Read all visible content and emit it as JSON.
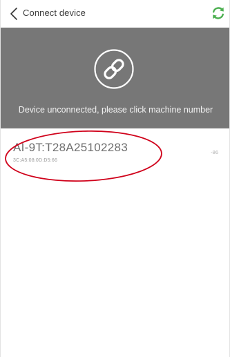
{
  "header": {
    "title": "Connect device",
    "back_icon": "chevron-left-icon",
    "refresh_icon": "refresh-icon",
    "accent_color": "#4caf50"
  },
  "banner": {
    "icon": "link-icon",
    "message": "Device unconnected, please click machine number",
    "background_color": "#777777"
  },
  "devices": [
    {
      "name": "AI-9T:T28A25102283",
      "mac": "3C:A5:08:0D:D5:66",
      "rssi": "-86"
    }
  ],
  "annotation": {
    "color": "#d0021b"
  }
}
